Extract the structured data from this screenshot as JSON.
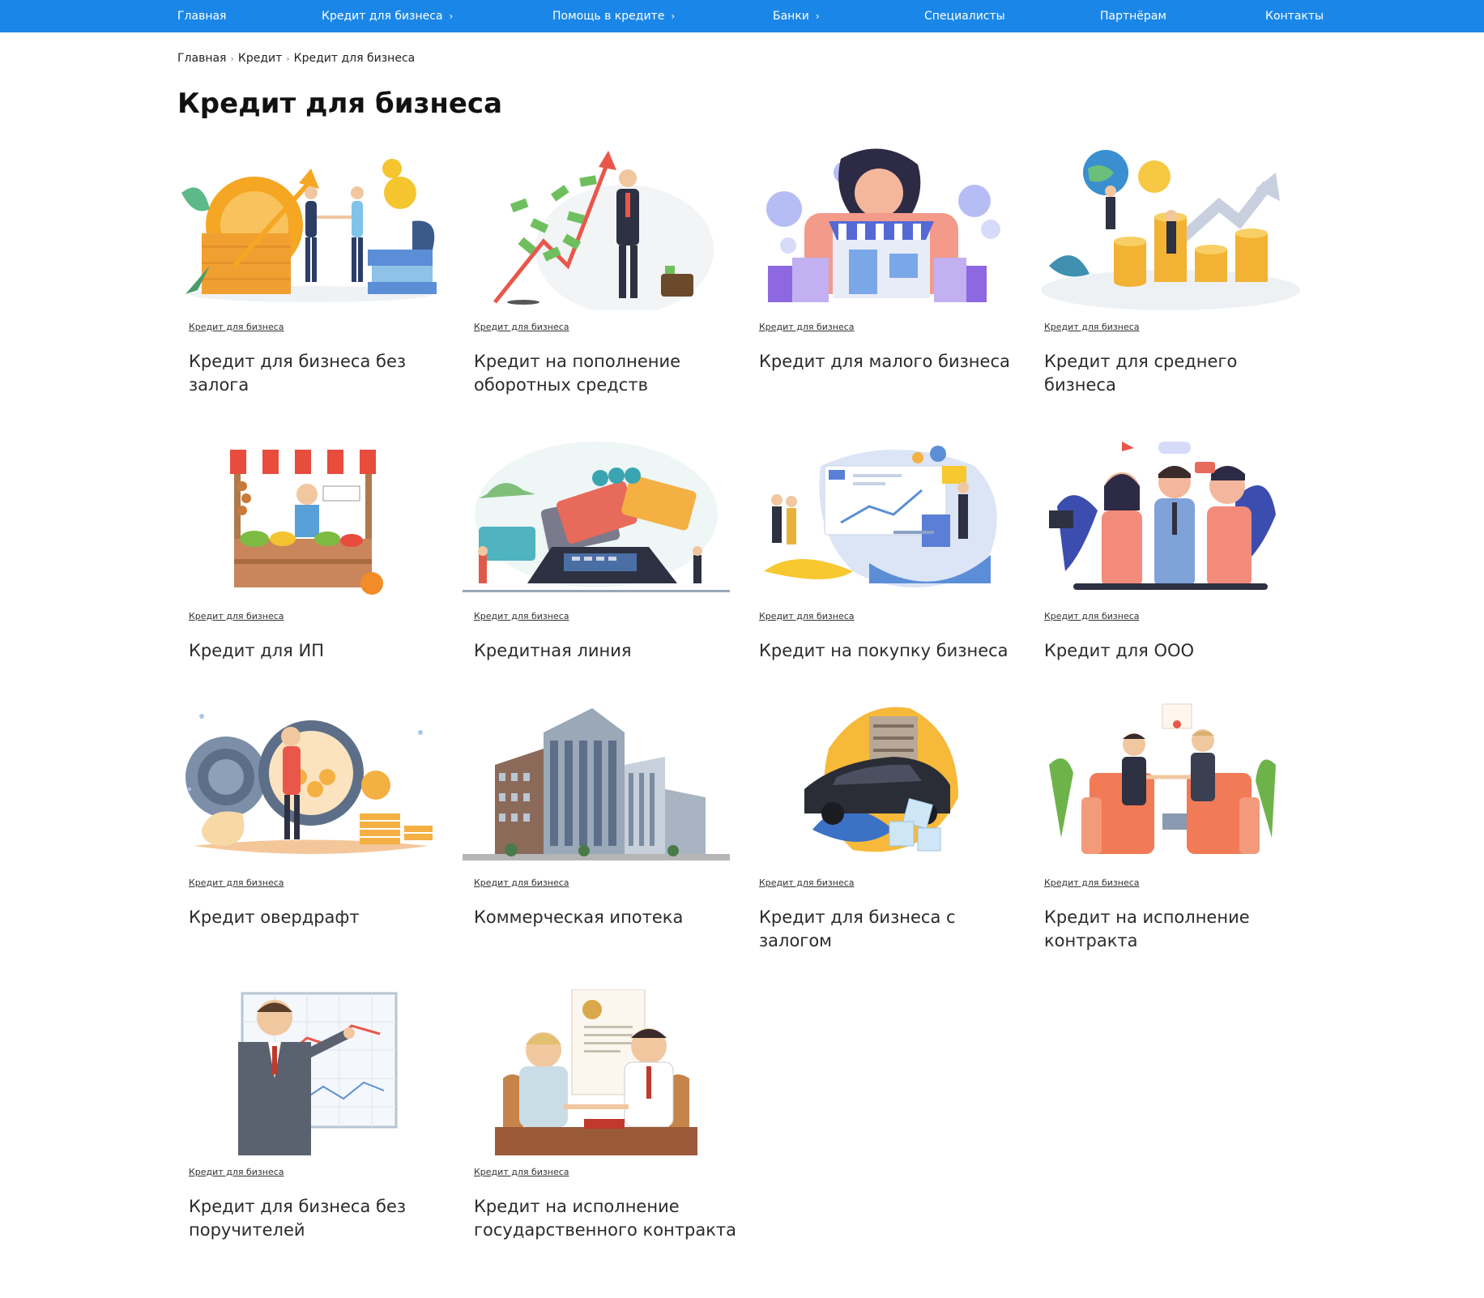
{
  "nav": {
    "items": [
      {
        "label": "Главная"
      },
      {
        "label": "Кредит для бизнеса"
      },
      {
        "label": "Помощь в кредите"
      },
      {
        "label": "Банки"
      },
      {
        "label": "Специалисты"
      },
      {
        "label": "Партнёрам"
      },
      {
        "label": "Контакты"
      }
    ],
    "chevron": "›"
  },
  "breadcrumb": {
    "items": [
      "Главная",
      "Кредит",
      "Кредит для бизнеса"
    ],
    "separator": "›"
  },
  "page": {
    "title": "Кредит для бизнеса"
  },
  "cards": [
    {
      "tag": "Кредит для бизнеса",
      "title": "Кредит для бизнеса без залога",
      "icon": "coins-handshake-illustration"
    },
    {
      "tag": "Кредит для бизнеса",
      "title": "Кредит на пополнение оборотных средств",
      "icon": "money-growth-arrow-illustration"
    },
    {
      "tag": "Кредит для бизнеса",
      "title": "Кредит для малого бизнеса",
      "icon": "small-shop-woman-illustration"
    },
    {
      "tag": "Кредит для бизнеса",
      "title": "Кредит для среднего бизнеса",
      "icon": "globe-coins-arrow-illustration"
    },
    {
      "tag": "Кредит для бизнеса",
      "title": "Кредит для ИП",
      "icon": "market-stall-illustration"
    },
    {
      "tag": "Кредит для бизнеса",
      "title": "Кредитная линия",
      "icon": "cards-terminal-illustration"
    },
    {
      "tag": "Кредит для бизнеса",
      "title": "Кредит на покупку бизнеса",
      "icon": "office-dashboard-illustration"
    },
    {
      "tag": "Кредит для бизнеса",
      "title": "Кредит для ООО",
      "icon": "business-team-illustration"
    },
    {
      "tag": "Кредит для бизнеса",
      "title": "Кредит овердрафт",
      "icon": "bank-vault-illustration"
    },
    {
      "tag": "Кредит для бизнеса",
      "title": "Коммерческая ипотека",
      "icon": "office-building-illustration"
    },
    {
      "tag": "Кредит для бизнеса",
      "title": "Кредит для бизнеса с залогом",
      "icon": "car-frozen-illustration"
    },
    {
      "tag": "Кредит для бизнеса",
      "title": "Кредит на исполнение контракта",
      "icon": "handshake-armchairs-illustration"
    },
    {
      "tag": "Кредит для бизнеса",
      "title": "Кредит для бизнеса без поручителей",
      "icon": "presenter-chart-illustration"
    },
    {
      "tag": "Кредит для бизнеса",
      "title": "Кредит на исполнение государственного контракта",
      "icon": "contract-signing-illustration"
    }
  ],
  "colors": {
    "nav_bg": "#1a87e8",
    "text": "#2b2b2b"
  }
}
